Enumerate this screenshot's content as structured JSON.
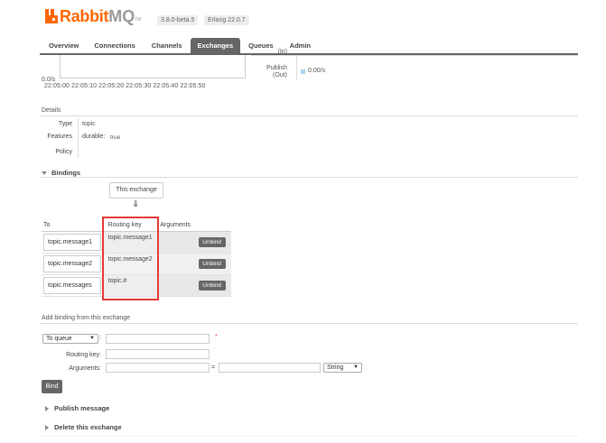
{
  "header": {
    "brand_rabbit": "Rabbit",
    "brand_mq": "MQ",
    "trademark": "TM",
    "version": "3.8.0-beta.5",
    "erlang": "Erlang 22.0.7"
  },
  "tabs": [
    {
      "label": "Overview"
    },
    {
      "label": "Connections"
    },
    {
      "label": "Channels"
    },
    {
      "label": "Exchanges",
      "active": true
    },
    {
      "label": "Queues"
    },
    {
      "label": "Admin"
    }
  ],
  "chart": {
    "y_zero": "0.0/s",
    "times": "22:05:00 22:05:10 22:05:20 22:05:30 22:05:40 22:05:50"
  },
  "rates": {
    "in_label": "(In)",
    "publish_label": "Publish",
    "out_label": "(Out)",
    "publish_out_value": "0.00/s",
    "series_color": "#aad4ef"
  },
  "details": {
    "title": "Details",
    "type_label": "Type",
    "type_value": "topic",
    "features_label": "Features",
    "durable_key": "durable:",
    "durable_value": "true",
    "policy_label": "Policy"
  },
  "bindings": {
    "title": "Bindings",
    "this_exchange": "This exchange",
    "arrow": "⇓",
    "headers": {
      "to": "To",
      "routing_key": "Routing key",
      "arguments": "Arguments"
    },
    "rows": [
      {
        "to": "topic.message1",
        "routing_key": "topic.message1",
        "action": "Unbind"
      },
      {
        "to": "topic.message2",
        "routing_key": "topic.message2",
        "action": "Unbind"
      },
      {
        "to": "topic.messages",
        "routing_key": "topic.#",
        "action": "Unbind"
      }
    ]
  },
  "add_binding": {
    "title": "Add binding from this exchange",
    "dest_select": "To queue",
    "colon": ":",
    "required_mark": "*",
    "routing_key_label": "Routing key:",
    "arguments_label": "Arguments:",
    "equals": "=",
    "type_select": "String",
    "bind_button": "Bind"
  },
  "sections": {
    "publish": "Publish message",
    "delete": "Delete this exchange"
  },
  "accent_color": "#ff6600",
  "highlight_color": "#e53935"
}
